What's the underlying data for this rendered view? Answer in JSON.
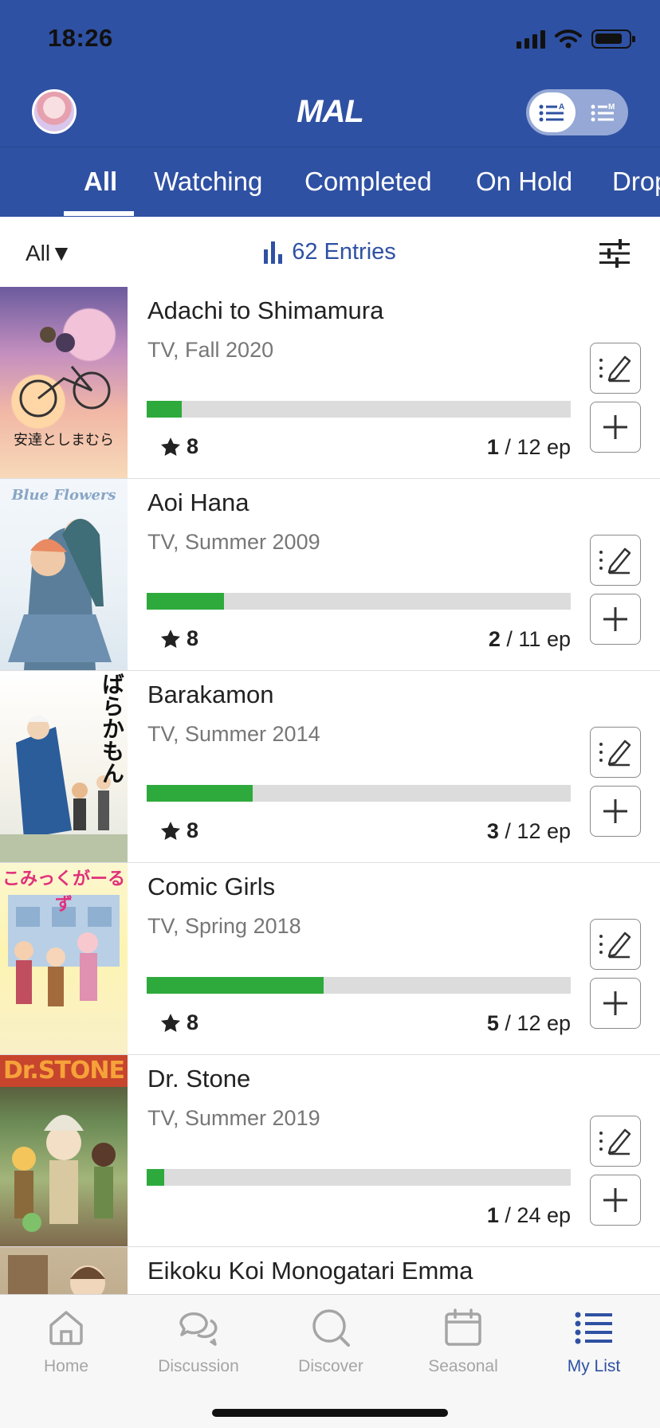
{
  "status_bar": {
    "time": "18:26"
  },
  "app": {
    "logo": "MAL"
  },
  "tabs": [
    {
      "label": "All",
      "active": true
    },
    {
      "label": "Watching",
      "active": false
    },
    {
      "label": "Completed",
      "active": false
    },
    {
      "label": "On Hold",
      "active": false
    },
    {
      "label": "Drop",
      "active": false
    }
  ],
  "filter": {
    "selected": "All▼",
    "entries": "62 Entries"
  },
  "anime": [
    {
      "title": "Adachi to Shimamura",
      "meta": "TV, Fall 2020",
      "score": "8",
      "watched": "1",
      "total": "/ 12 ep",
      "progress": 0.0833,
      "cover_label": "安達としまむら"
    },
    {
      "title": "Aoi Hana",
      "meta": "TV, Summer 2009",
      "score": "8",
      "watched": "2",
      "total": "/ 11 ep",
      "progress": 0.1818,
      "cover_label": "Blue Flowers"
    },
    {
      "title": "Barakamon",
      "meta": "TV, Summer 2014",
      "score": "8",
      "watched": "3",
      "total": "/ 12 ep",
      "progress": 0.25,
      "cover_label": "ばらかもん"
    },
    {
      "title": "Comic Girls",
      "meta": "TV, Spring 2018",
      "score": "8",
      "watched": "5",
      "total": "/ 12 ep",
      "progress": 0.4167,
      "cover_label": "こみっくがーるず"
    },
    {
      "title": "Dr. Stone",
      "meta": "TV, Summer 2019",
      "score": "",
      "watched": "1",
      "total": "/ 24 ep",
      "progress": 0.0417,
      "cover_label": "Dr.STONE"
    },
    {
      "title": "Eikoku Koi Monogatari Emma",
      "meta": "",
      "score": "",
      "watched": "",
      "total": "",
      "progress": 0,
      "cover_label": ""
    }
  ],
  "bottom_nav": [
    {
      "label": "Home",
      "icon": "home-icon",
      "active": false
    },
    {
      "label": "Discussion",
      "icon": "chat-bubbles-icon",
      "active": false
    },
    {
      "label": "Discover",
      "icon": "search-icon",
      "active": false
    },
    {
      "label": "Seasonal",
      "icon": "calendar-icon",
      "active": false
    },
    {
      "label": "My List",
      "icon": "list-icon",
      "active": true
    }
  ],
  "colors": {
    "brand_blue": "#2f51a3",
    "progress_green": "#2eaa3c",
    "progress_track": "#dcdcdc",
    "inactive_gray": "#a5a5a5"
  }
}
